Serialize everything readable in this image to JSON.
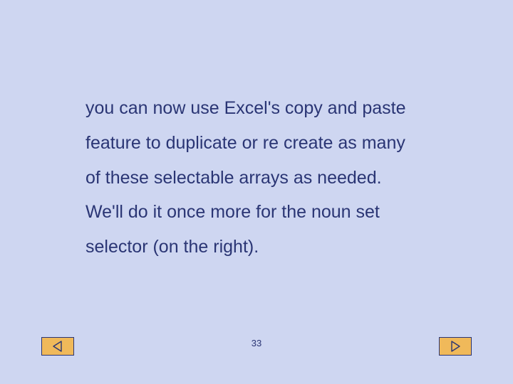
{
  "slide": {
    "body_text": "you can now use Excel's copy and paste feature to duplicate or re create as many of these selectable arrays  as needed. We'll do it once more for the noun set selector (on the right).",
    "page_number": "33"
  },
  "nav": {
    "prev_label": "Previous",
    "next_label": "Next"
  },
  "colors": {
    "background": "#ced6f1",
    "text": "#2a3574",
    "button_fill": "#f0b95a"
  }
}
